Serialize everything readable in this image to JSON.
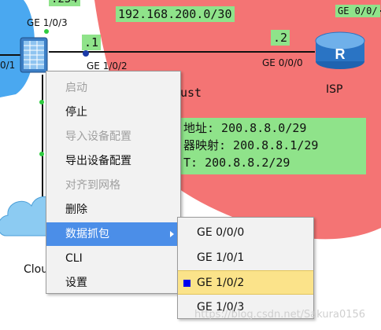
{
  "topology": {
    "top_partial_label": ".254",
    "network_label": "192.168.200.0/30",
    "left_device_port_top": "GE 1/0/3",
    "left_device_port_left": "0/1",
    "left_device_port_right": "GE 1/0/2",
    "left_ip_suffix": ".1",
    "right_ip_suffix": ".2",
    "isp_port_bottom": "GE 0/0/0",
    "isp_port_top": "GE 0/0/",
    "isp_label": "ISP",
    "zone_partial": "ust",
    "nat_line1": "地址: 200.8.8.0/29",
    "nat_line2": "器映射: 200.8.8.1/29",
    "nat_line3": "T: 200.8.8.2/29",
    "cloud_label": "Clou",
    "colors": {
      "zone_red": "#f47474",
      "label_green": "#8fe38a",
      "link_blue": "#1a3aa8"
    }
  },
  "context_menu": {
    "items": [
      {
        "label": "启动",
        "enabled": false
      },
      {
        "label": "停止",
        "enabled": true
      },
      {
        "label": "导入设备配置",
        "enabled": false
      },
      {
        "label": "导出设备配置",
        "enabled": true
      },
      {
        "label": "对齐到网格",
        "enabled": false
      },
      {
        "label": "删除",
        "enabled": true
      },
      {
        "label": "数据抓包",
        "enabled": true,
        "highlighted": true,
        "has_submenu": true
      },
      {
        "label": "CLI",
        "enabled": true
      },
      {
        "label": "设置",
        "enabled": true
      }
    ]
  },
  "capture_submenu": {
    "items": [
      {
        "label": "GE 0/0/0",
        "selected": false
      },
      {
        "label": "GE 1/0/1",
        "selected": false
      },
      {
        "label": "GE 1/0/2",
        "selected": true
      },
      {
        "label": "GE 1/0/3",
        "selected": false
      }
    ]
  },
  "watermark": "https://blog.csdn.net/Sakura0156"
}
